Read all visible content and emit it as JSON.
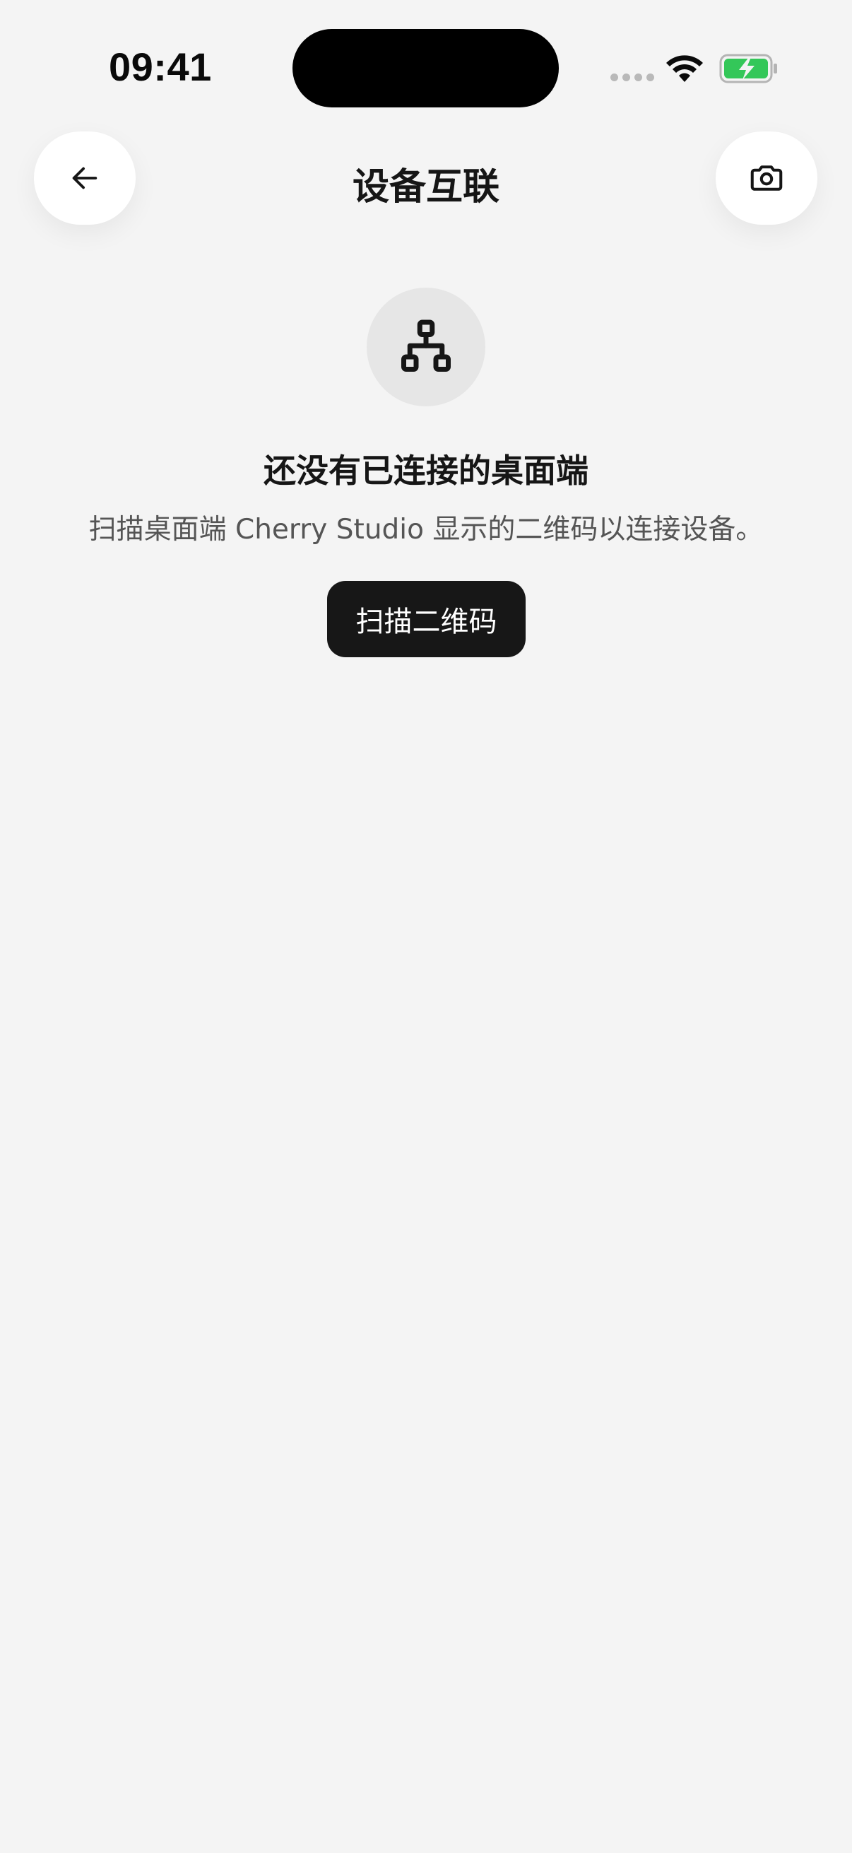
{
  "status_bar": {
    "time": "09:41",
    "battery_color": "#34c759"
  },
  "header": {
    "title": "设备互联",
    "back_icon": "arrow-left-icon",
    "camera_icon": "camera-icon"
  },
  "empty_state": {
    "icon": "network-hierarchy-icon",
    "title": "还没有已连接的桌面端",
    "description": "扫描桌面端 Cherry Studio 显示的二维码以连接设备。",
    "button_label": "扫描二维码"
  },
  "colors": {
    "background": "#f4f4f4",
    "button_dark": "#171717",
    "icon_circle": "#e6e6e6"
  }
}
